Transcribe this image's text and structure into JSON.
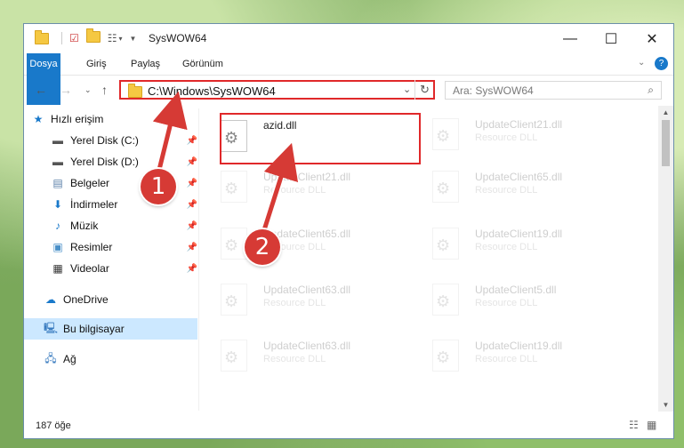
{
  "window": {
    "title": "SysWOW64"
  },
  "ribbon": {
    "tabs": [
      "Dosya",
      "Giriş",
      "Paylaş",
      "Görünüm"
    ]
  },
  "address": {
    "path": "C:\\Windows\\SysWOW64"
  },
  "search": {
    "placeholder": "Ara: SysWOW64"
  },
  "sidebar": {
    "items": [
      {
        "label": "Hızlı erişim"
      },
      {
        "label": "Yerel Disk (C:)"
      },
      {
        "label": "Yerel Disk (D:)"
      },
      {
        "label": "Belgeler"
      },
      {
        "label": "İndirmeler"
      },
      {
        "label": "Müzik"
      },
      {
        "label": "Resimler"
      },
      {
        "label": "Videolar"
      },
      {
        "label": "OneDrive"
      },
      {
        "label": "Bu bilgisayar"
      },
      {
        "label": "Ağ"
      }
    ]
  },
  "files": [
    {
      "name": "azid.dll",
      "type": ""
    },
    {
      "name": "UpdateClient21.dll",
      "type": "Resource DLL"
    },
    {
      "name": "UpdateClient21.dll",
      "type": "Resource DLL"
    },
    {
      "name": "UpdateClient65.dll",
      "type": "Resource DLL"
    },
    {
      "name": "UpdateClient65.dll",
      "type": "Resource DLL"
    },
    {
      "name": "UpdateClient19.dll",
      "type": "Resource DLL"
    },
    {
      "name": "UpdateClient63.dll",
      "type": "Resource DLL"
    },
    {
      "name": "UpdateClient5.dll",
      "type": "Resource DLL"
    },
    {
      "name": "UpdateClient63.dll",
      "type": "Resource DLL"
    },
    {
      "name": "UpdateClient19.dll",
      "type": "Resource DLL"
    }
  ],
  "status": {
    "count": "187 öğe"
  },
  "callouts": [
    "1",
    "2"
  ],
  "colors": {
    "accent": "#1979ca",
    "highlight": "#e0282a",
    "selection": "#cce8ff"
  }
}
